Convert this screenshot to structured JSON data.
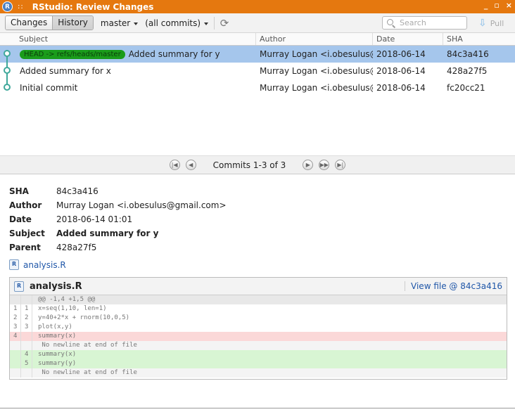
{
  "window": {
    "title": "RStudio: Review Changes",
    "icon_letter": "R",
    "grip": "::",
    "controls": [
      "_",
      "▫",
      "×"
    ]
  },
  "toolbar": {
    "tabs": [
      {
        "label": "Changes",
        "active": false
      },
      {
        "label": "History",
        "active": true
      }
    ],
    "branch": "master",
    "commits_filter": "(all commits)",
    "search_placeholder": "Search",
    "pull_label": "Pull"
  },
  "table": {
    "columns": [
      "Subject",
      "Author",
      "Date",
      "SHA"
    ],
    "rows": [
      {
        "ref": "HEAD -> refs/heads/master",
        "subject": "Added summary for y",
        "author": "Murray Logan <i.obesulus@gmail.com>",
        "date": "2018-06-14",
        "sha": "84c3a416",
        "selected": true
      },
      {
        "ref": "",
        "subject": "Added summary for x",
        "author": "Murray Logan <i.obesulus@gmail.com>",
        "date": "2018-06-14",
        "sha": "428a27f5",
        "selected": false
      },
      {
        "ref": "",
        "subject": "Initial commit",
        "author": "Murray Logan <i.obesulus@gmail.com>",
        "date": "2018-06-14",
        "sha": "fc20cc21",
        "selected": false
      }
    ]
  },
  "pager": {
    "label": "Commits 1-3 of 3"
  },
  "details": {
    "sha_label": "SHA",
    "sha": "84c3a416",
    "author_label": "Author",
    "author": "Murray Logan <i.obesulus@gmail.com>",
    "date_label": "Date",
    "date": "2018-06-14 01:01",
    "subject_label": "Subject",
    "subject": "Added summary for y",
    "parent_label": "Parent",
    "parent": "428a27f5",
    "file_link": "analysis.R"
  },
  "diff": {
    "filename": "analysis.R",
    "view_file": "View file @ 84c3a416",
    "hunk": "@@ -1,4 +1,5 @@",
    "lines": [
      {
        "type": "ctx",
        "old": "1",
        "new": "1",
        "code": "x=seq(1,10, len=1)"
      },
      {
        "type": "ctx",
        "old": "2",
        "new": "2",
        "code": "y=40+2*x + rnorm(10,0,5)"
      },
      {
        "type": "ctx",
        "old": "3",
        "new": "3",
        "code": "plot(x,y)"
      },
      {
        "type": "del",
        "old": "4",
        "new": "",
        "code": "summary(x)"
      },
      {
        "type": "nonl",
        "old": "",
        "new": "",
        "code": " No newline at end of file"
      },
      {
        "type": "add",
        "old": "",
        "new": "4",
        "code": "summary(x)"
      },
      {
        "type": "add",
        "old": "",
        "new": "5",
        "code": "summary(y)"
      },
      {
        "type": "nonl",
        "old": "",
        "new": "",
        "code": " No newline at end of file"
      }
    ]
  }
}
